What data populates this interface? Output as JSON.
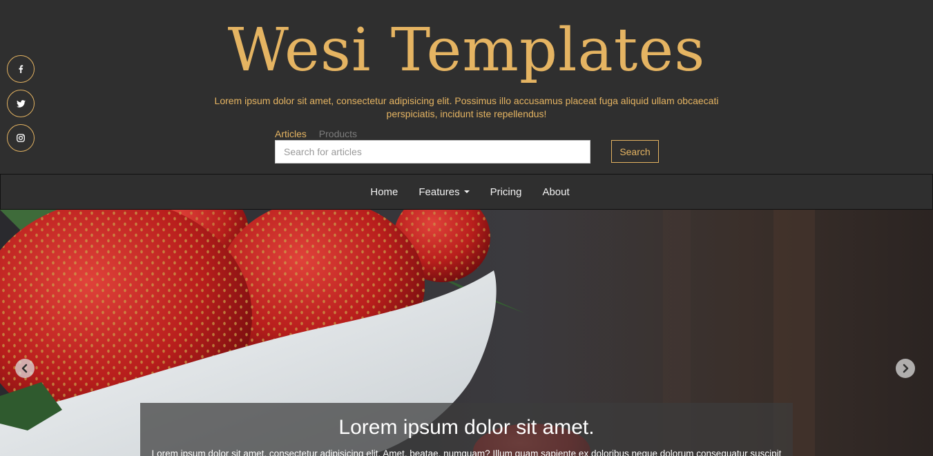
{
  "header": {
    "title": "Wesi Templates",
    "tagline": "Lorem ipsum dolor sit amet, consectetur adipisicing elit. Possimus illo accusamus placeat fuga aliquid ullam obcaecati perspiciatis, incidunt iste repellendus!"
  },
  "social": {
    "facebook_icon": "facebook-icon",
    "twitter_icon": "twitter-icon",
    "instagram_icon": "instagram-icon"
  },
  "search": {
    "tabs": [
      {
        "label": "Articles",
        "active": true
      },
      {
        "label": "Products",
        "active": false
      }
    ],
    "placeholder": "Search for articles",
    "value": "",
    "button_label": "Search"
  },
  "nav": {
    "items": [
      {
        "label": "Home"
      },
      {
        "label": "Features",
        "dropdown": true
      },
      {
        "label": "Pricing"
      },
      {
        "label": "About"
      }
    ]
  },
  "carousel": {
    "image": "strawberries-in-white-bowl",
    "caption_title": "Lorem ipsum dolor sit amet.",
    "caption_text": "Lorem ipsum dolor sit amet, consectetur adipisicing elit. Amet, beatae, numquam? Illum quam sapiente ex doloribus neque dolorum consequatur suscipit",
    "prev_icon": "chevron-left-icon",
    "next_icon": "chevron-right-icon"
  },
  "colors": {
    "accent": "#e5b462",
    "background": "#2f2f2f",
    "nav_text": "#f2f2f2"
  }
}
